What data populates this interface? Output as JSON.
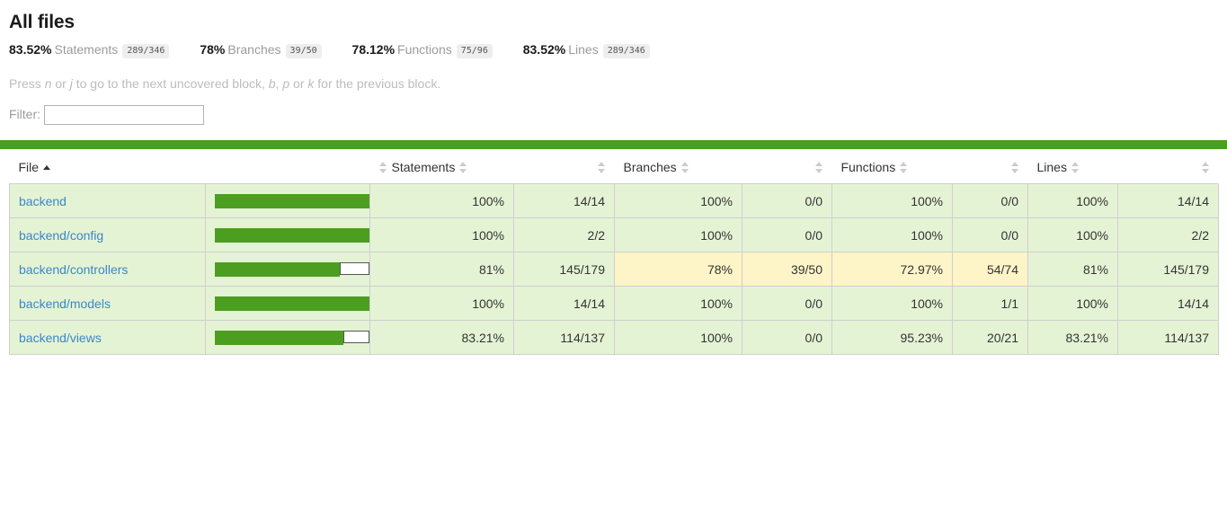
{
  "page": {
    "title": "All files",
    "hint_prefix": "Press ",
    "hint_key1": "n",
    "hint_mid1": " or ",
    "hint_key2": "j",
    "hint_mid2": " to go to the next uncovered block, ",
    "hint_key3": "b",
    "hint_mid3": ", ",
    "hint_key4": "p",
    "hint_mid4": " or ",
    "hint_key5": "k",
    "hint_suffix": " for the previous block."
  },
  "summary": [
    {
      "pct": "83.52%",
      "label": "Statements",
      "fraction": "289/346"
    },
    {
      "pct": "78%",
      "label": "Branches",
      "fraction": "39/50"
    },
    {
      "pct": "78.12%",
      "label": "Functions",
      "fraction": "75/96"
    },
    {
      "pct": "83.52%",
      "label": "Lines",
      "fraction": "289/346"
    }
  ],
  "filter": {
    "label": "Filter:",
    "value": "",
    "placeholder": ""
  },
  "status_bar": {
    "color": "#4c9e21",
    "level": "high"
  },
  "table": {
    "headers": {
      "file": "File",
      "statements": "Statements",
      "branches": "Branches",
      "functions": "Functions",
      "lines": "Lines"
    },
    "sort": {
      "column": "File",
      "direction": "asc"
    },
    "rows": [
      {
        "file": "backend",
        "bar_pct": 100,
        "statements_pct": "100%",
        "statements_abs": "14/14",
        "statements_level": "high",
        "branches_pct": "100%",
        "branches_abs": "0/0",
        "branches_level": "high",
        "functions_pct": "100%",
        "functions_abs": "0/0",
        "functions_level": "high",
        "lines_pct": "100%",
        "lines_abs": "14/14",
        "lines_level": "high"
      },
      {
        "file": "backend/config",
        "bar_pct": 100,
        "statements_pct": "100%",
        "statements_abs": "2/2",
        "statements_level": "high",
        "branches_pct": "100%",
        "branches_abs": "0/0",
        "branches_level": "high",
        "functions_pct": "100%",
        "functions_abs": "0/0",
        "functions_level": "high",
        "lines_pct": "100%",
        "lines_abs": "2/2",
        "lines_level": "high"
      },
      {
        "file": "backend/controllers",
        "bar_pct": 81,
        "statements_pct": "81%",
        "statements_abs": "145/179",
        "statements_level": "high",
        "branches_pct": "78%",
        "branches_abs": "39/50",
        "branches_level": "medium",
        "functions_pct": "72.97%",
        "functions_abs": "54/74",
        "functions_level": "medium",
        "lines_pct": "81%",
        "lines_abs": "145/179",
        "lines_level": "high"
      },
      {
        "file": "backend/models",
        "bar_pct": 100,
        "statements_pct": "100%",
        "statements_abs": "14/14",
        "statements_level": "high",
        "branches_pct": "100%",
        "branches_abs": "0/0",
        "branches_level": "high",
        "functions_pct": "100%",
        "functions_abs": "1/1",
        "functions_level": "high",
        "lines_pct": "100%",
        "lines_abs": "14/14",
        "lines_level": "high"
      },
      {
        "file": "backend/views",
        "bar_pct": 83.21,
        "statements_pct": "83.21%",
        "statements_abs": "114/137",
        "statements_level": "high",
        "branches_pct": "100%",
        "branches_abs": "0/0",
        "branches_level": "high",
        "functions_pct": "95.23%",
        "functions_abs": "20/21",
        "functions_level": "high",
        "lines_pct": "83.21%",
        "lines_abs": "114/137",
        "lines_level": "high"
      }
    ]
  },
  "colors": {
    "bar_green": "#4c9e21",
    "row_high": "#e5f3d5",
    "row_medium": "#fdf4c8",
    "link": "#3a87c8"
  }
}
